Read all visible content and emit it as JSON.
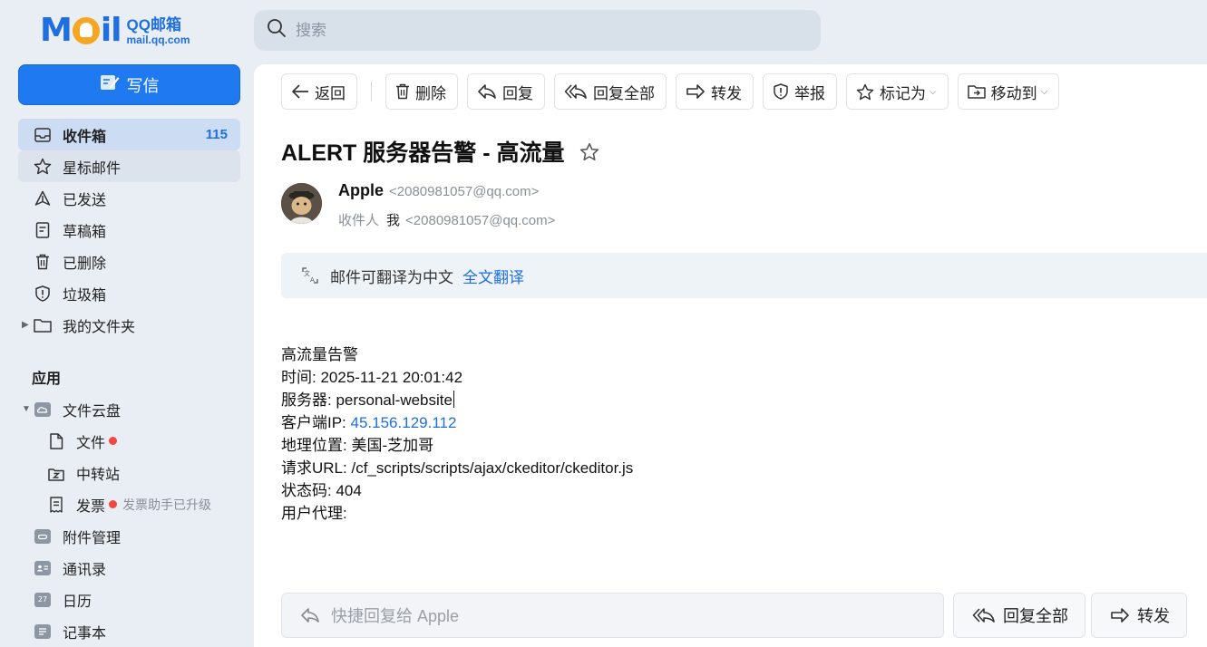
{
  "logo": {
    "big": "Mail",
    "small_top": "QQ邮箱",
    "small_bottom": "mail.qq.com"
  },
  "search": {
    "placeholder": "搜索"
  },
  "sidebar": {
    "compose_label": "写信",
    "items": [
      {
        "label": "收件箱",
        "count": "115",
        "icon": "inbox-icon"
      },
      {
        "label": "星标邮件",
        "icon": "star-icon"
      },
      {
        "label": "已发送",
        "icon": "sent-icon"
      },
      {
        "label": "草稿箱",
        "icon": "draft-icon"
      },
      {
        "label": "已删除",
        "icon": "trash-icon"
      },
      {
        "label": "垃圾箱",
        "icon": "spam-icon"
      },
      {
        "label": "我的文件夹",
        "icon": "folder-icon"
      }
    ],
    "apps_title": "应用",
    "apps": [
      {
        "label": "文件云盘",
        "icon": "cloud-drive-icon"
      },
      {
        "label": "文件",
        "icon": "file-icon"
      },
      {
        "label": "中转站",
        "icon": "transfer-station-icon"
      },
      {
        "label": "发票",
        "icon": "invoice-icon",
        "note": "发票助手已升级"
      },
      {
        "label": "附件管理",
        "icon": "attachment-icon"
      },
      {
        "label": "通讯录",
        "icon": "contacts-icon"
      },
      {
        "label": "日历",
        "icon": "calendar-icon",
        "badge": "27"
      },
      {
        "label": "记事本",
        "icon": "notepad-icon"
      }
    ]
  },
  "toolbar": {
    "back": "返回",
    "delete": "删除",
    "reply": "回复",
    "reply_all": "回复全部",
    "forward": "转发",
    "report": "举报",
    "mark_as": "标记为",
    "move_to": "移动到"
  },
  "mail": {
    "subject": "ALERT 服务器告警 - 高流量",
    "sender_name": "Apple",
    "sender_addr": "<2080981057@qq.com>",
    "recipient_label": "收件人",
    "recipient_name": "我",
    "recipient_addr": "<2080981057@qq.com>",
    "translate_text": "邮件可翻译为中文",
    "translate_link": "全文翻译",
    "body": {
      "line1": "高流量告警",
      "time_label": "时间: ",
      "time_value": "2025-11-21 20:01:42",
      "server_label": "服务器: ",
      "server_value": "personal-website",
      "ip_label": "客户端IP: ",
      "ip_value": "45.156.129.112",
      "geo_label": "地理位置: ",
      "geo_value": "美国-芝加哥",
      "url_label": "请求URL: ",
      "url_value": "/cf_scripts/scripts/ajax/ckeditor/ckeditor.js",
      "status_label": "状态码: ",
      "status_value": "404",
      "ua_label": "用户代理:"
    }
  },
  "bottom": {
    "quick_reply_placeholder": "快捷回复给 Apple",
    "reply_all": "回复全部",
    "forward": "转发"
  },
  "colors": {
    "accent": "#1f7af2",
    "link": "#1f6fe0",
    "logo_orange": "#f5a623",
    "dot": "#f0483e"
  }
}
